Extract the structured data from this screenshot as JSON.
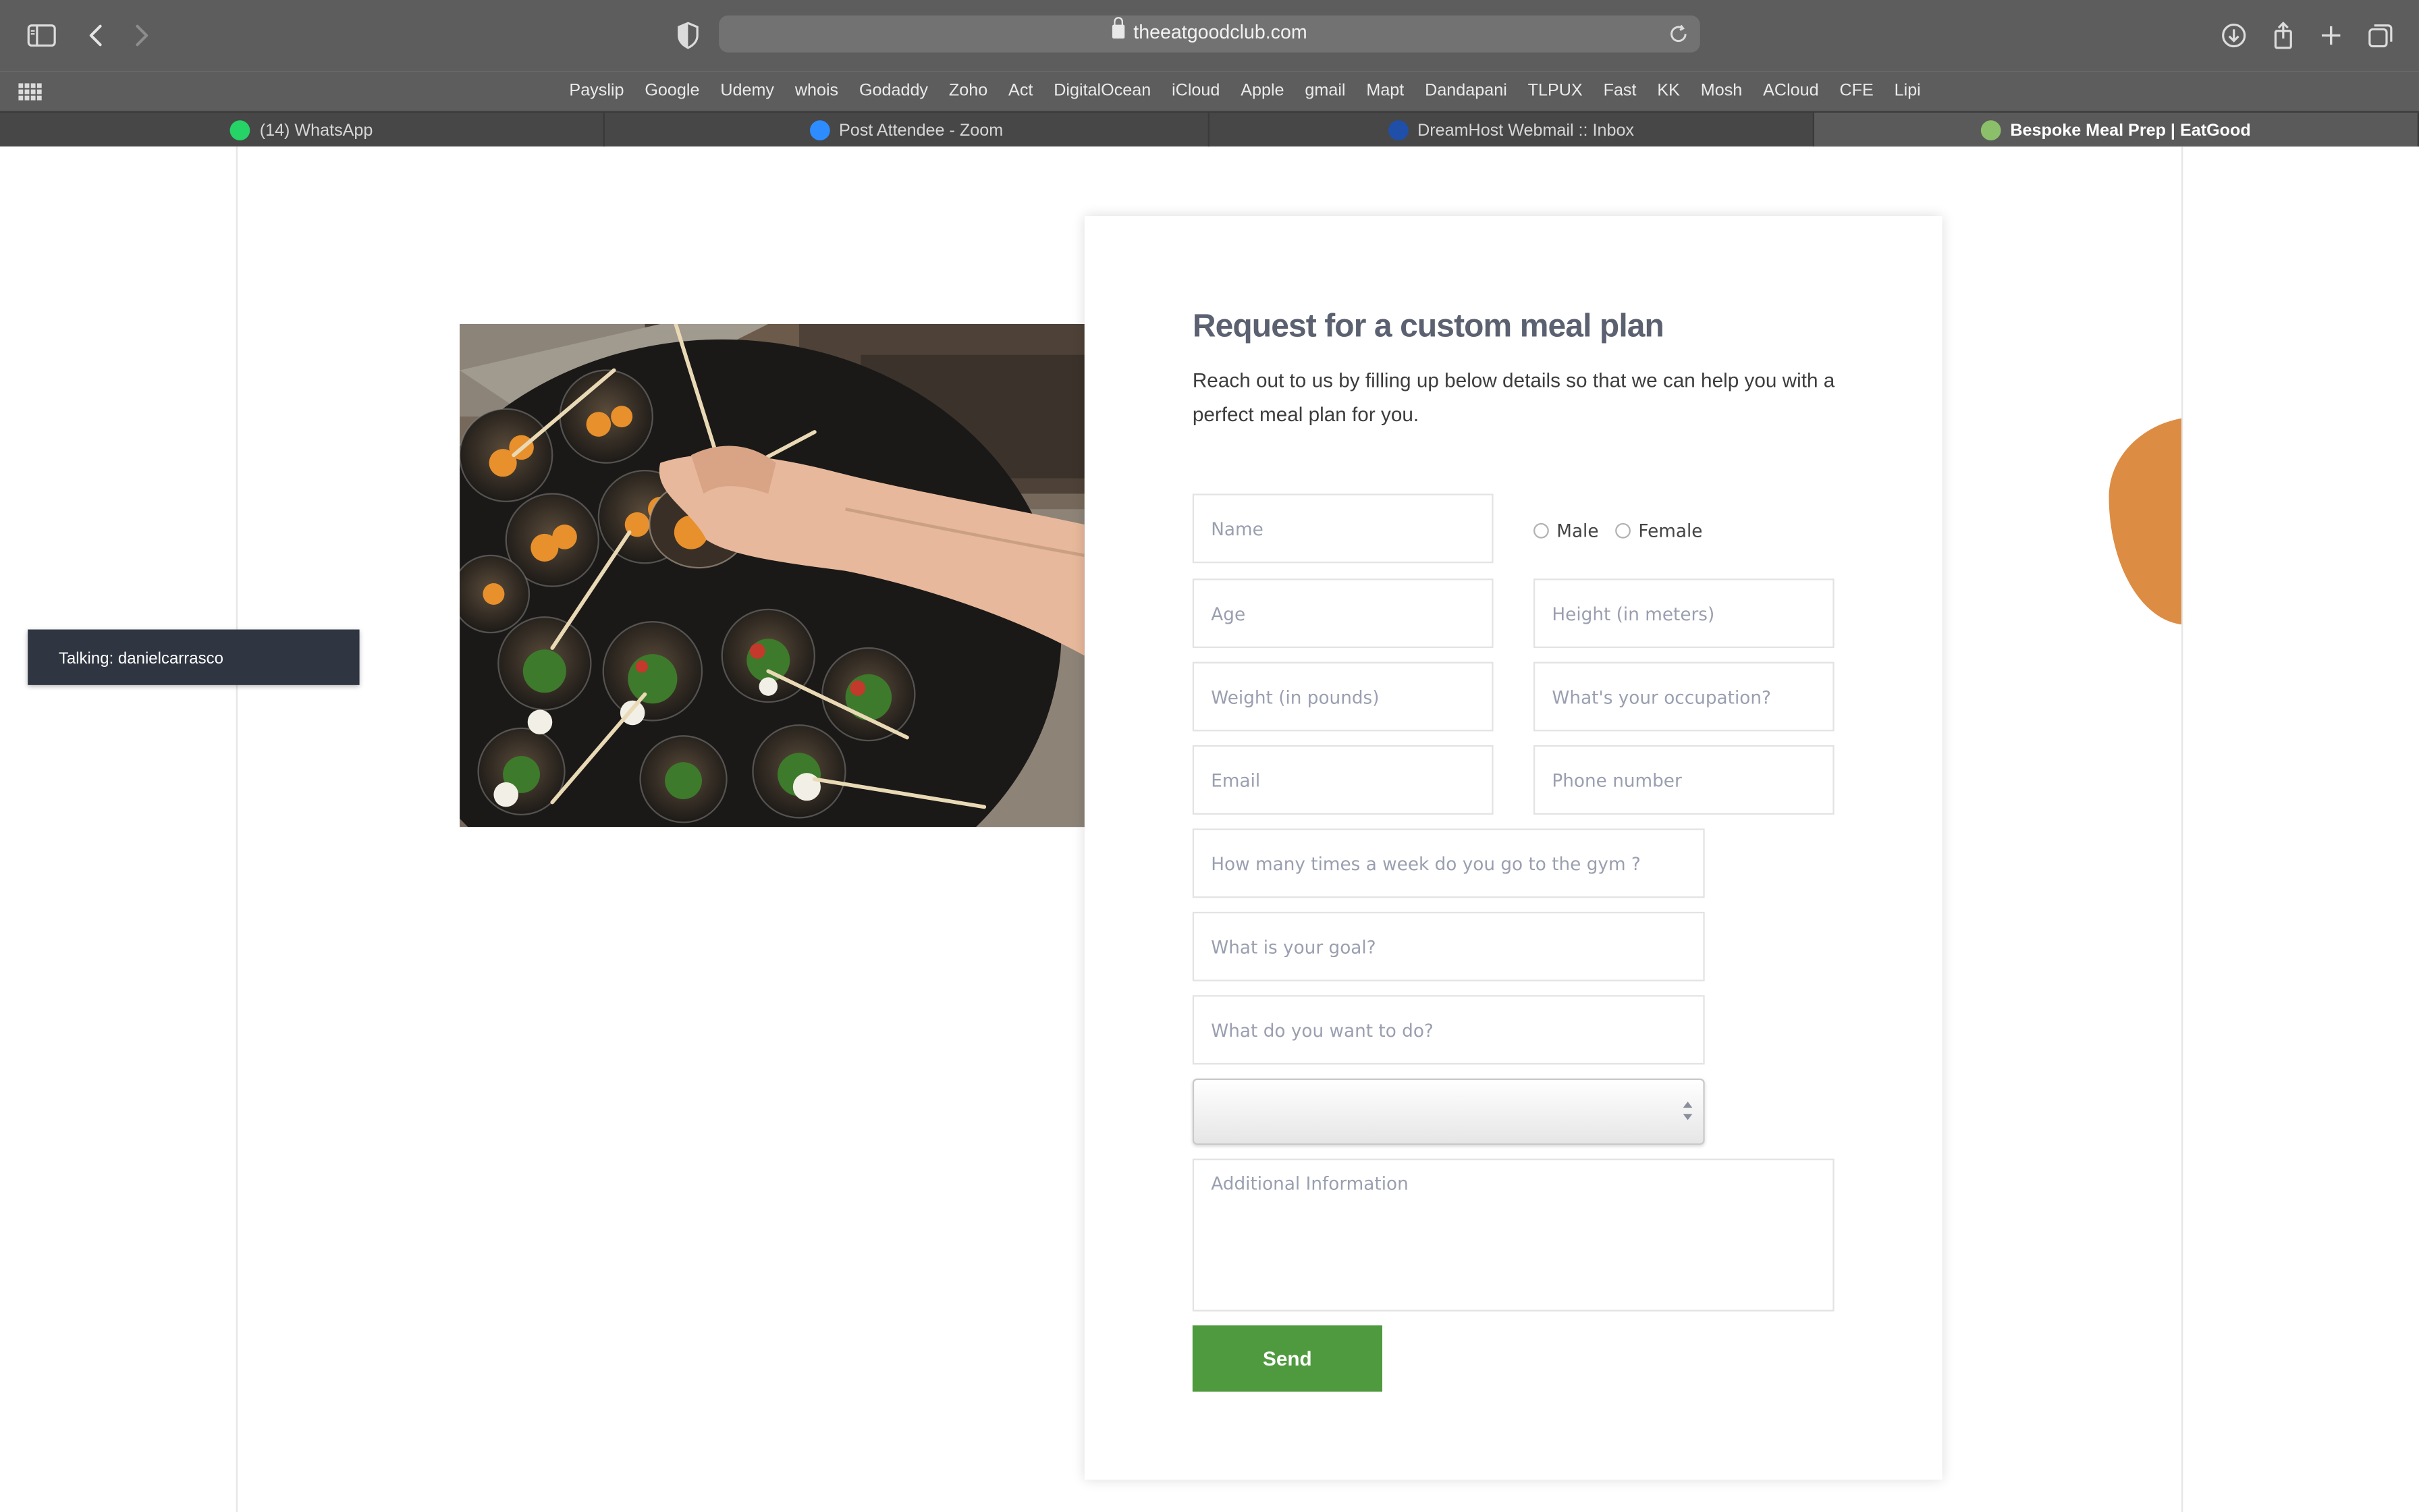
{
  "browser": {
    "url": "theeatgoodclub.com",
    "bookmarks": [
      "Payslip",
      "Google",
      "Udemy",
      "whois",
      "Godaddy",
      "Zoho",
      "Act",
      "DigitalOcean",
      "iCloud",
      "Apple",
      "gmail",
      "Mapt",
      "Dandapani",
      "TLPUX",
      "Fast",
      "KK",
      "Mosh",
      "ACloud",
      "CFE",
      "Lipi"
    ],
    "tabs": [
      {
        "label": "(14) WhatsApp",
        "icon": "whatsapp-icon",
        "color": "#25d366"
      },
      {
        "label": "Post Attendee - Zoom",
        "icon": "zoom-icon",
        "color": "#2d8cff"
      },
      {
        "label": "DreamHost Webmail :: Inbox",
        "icon": "dreamhost-icon",
        "color": "#1f4fa8"
      },
      {
        "label": "Bespoke Meal Prep | EatGood",
        "icon": "eatgood-icon",
        "color": "#8bbf6a",
        "active": true
      }
    ]
  },
  "form": {
    "title": "Request for a custom meal plan",
    "description": "Reach out to us by filling up below details so that we can help you with a perfect meal plan for you.",
    "name_placeholder": "Name",
    "gender_options": [
      "Male",
      "Female"
    ],
    "age_placeholder": "Age",
    "height_placeholder": "Height (in meters)",
    "weight_placeholder": "Weight (in pounds)",
    "occupation_placeholder": "What's your occupation?",
    "email_placeholder": "Email",
    "phone_placeholder": "Phone number",
    "gym_placeholder": "How many times a week do you go to the gym ?",
    "goal_placeholder": "What is your goal?",
    "todo_placeholder": "What do you want to do?",
    "select_value": "",
    "additional_placeholder": "Additional Information",
    "send_label": "Send"
  },
  "overlay": {
    "talking_label": "Talking: danielcarrasco"
  },
  "colors": {
    "send_button": "#4f9a3e",
    "title_text": "#5b6170",
    "accent_blob": "#dd8c43",
    "talking_bg": "#2f3641"
  }
}
